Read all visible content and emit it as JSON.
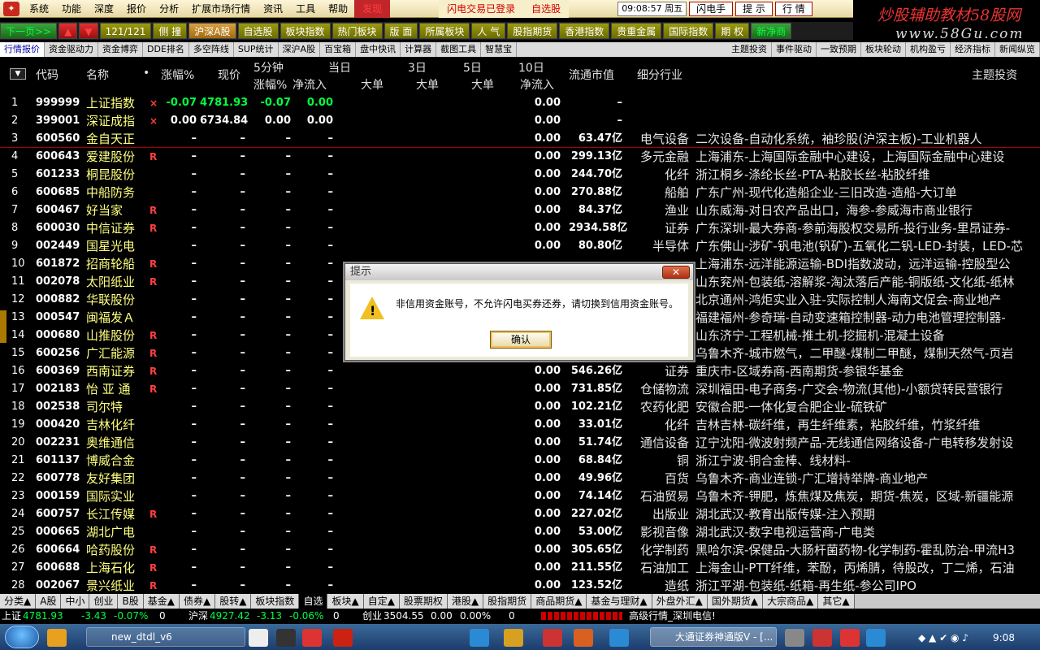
{
  "menubar": {
    "items": [
      "系统",
      "功能",
      "深度",
      "报价",
      "分析",
      "扩展市场行情",
      "资讯",
      "工具",
      "帮助"
    ],
    "discover": "发现",
    "notice1": "闪电交易已登录",
    "notice2": "自选股",
    "clock": "09:08:57 周五",
    "buttons": [
      "闪电手",
      "提 示",
      "行 情"
    ]
  },
  "brand": {
    "title_main": "炒股辅助教材",
    "title_red": "58股网",
    "url": "www.58Gu.com"
  },
  "toolbar": {
    "items": [
      {
        "label": "下一页>>",
        "style": "green"
      },
      {
        "label": "▲",
        "style": "red"
      },
      {
        "label": "▼",
        "style": "red"
      },
      {
        "label": "121/121",
        "style": "olive"
      },
      {
        "label": "侧 撞",
        "style": "olive"
      },
      {
        "label": "沪深A股",
        "style": "hl"
      },
      {
        "label": "自选股",
        "style": "olive"
      },
      {
        "label": "板块指数",
        "style": "olive"
      },
      {
        "label": "热门板块",
        "style": "olive"
      },
      {
        "label": "版 面",
        "style": "olive"
      },
      {
        "label": "所属板块",
        "style": "olive"
      },
      {
        "label": "人 气",
        "style": "olive"
      },
      {
        "label": "股指期货",
        "style": "olive"
      },
      {
        "label": "香港指数",
        "style": "olive"
      },
      {
        "label": "贵重金属",
        "style": "olive"
      },
      {
        "label": "国际指数",
        "style": "olive"
      },
      {
        "label": "期 权",
        "style": "olive"
      },
      {
        "label": "新净商",
        "style": "green"
      }
    ]
  },
  "tabs": {
    "left": [
      "行情报价",
      "资金驱动力",
      "资金博弈",
      "DDE排名",
      "多空阵线",
      "SUP统计",
      "深沪A股",
      "百宝箱",
      "盘中快讯",
      "计算器",
      "截图工具",
      "智慧宝"
    ],
    "right": [
      "主题投资",
      "事件驱动",
      "一致预期",
      "板块轮动",
      "机构盈亏",
      "经济指标",
      "新闻纵览"
    ]
  },
  "header": {
    "code": "代码",
    "name": "名称",
    "dot": "•",
    "pct": "涨幅%",
    "price": "现价",
    "min5": "5分钟",
    "min5_sub": "涨幅%",
    "flow": "净流入",
    "today": "当日",
    "today_sub": "大单",
    "d3": "3日",
    "d3_sub": "大单",
    "d5": "5日",
    "d5_sub": "大单",
    "d10": "10日",
    "d10_sub": "净流入",
    "mv": "流通市值",
    "industry": "细分行业",
    "theme": "主题投资"
  },
  "rows": [
    {
      "idx": "1",
      "code": "999999",
      "name": "上证指数",
      "flag": "×",
      "pct": "-0.07",
      "price": "4781.93",
      "m5": "-0.07",
      "flow": "0.00",
      "d1": "",
      "d3": "",
      "d5": "",
      "net": "0.00",
      "mv": "–",
      "ind": "",
      "theme": "",
      "color": "green"
    },
    {
      "idx": "2",
      "code": "399001",
      "name": "深证成指",
      "flag": "×",
      "pct": "0.00",
      "price": "6734.84",
      "m5": "0.00",
      "flow": "0.00",
      "d1": "",
      "d3": "",
      "d5": "",
      "net": "0.00",
      "mv": "–",
      "ind": "",
      "theme": "",
      "color": "white"
    },
    {
      "idx": "3",
      "code": "600560",
      "name": "金自天正",
      "flag": "",
      "pct": "–",
      "price": "–",
      "m5": "–",
      "flow": "–",
      "d1": "",
      "d3": "",
      "d5": "",
      "net": "0.00",
      "mv": "63.47亿",
      "ind": "电气设备",
      "theme": "二次设备-自动化系统，袖珍股(沪深主板)-工业机器人",
      "color": "white"
    },
    {
      "idx": "4",
      "code": "600643",
      "name": "爱建股份",
      "flag": "R",
      "pct": "–",
      "price": "–",
      "m5": "–",
      "flow": "–",
      "d1": "",
      "d3": "",
      "d5": "",
      "net": "0.00",
      "mv": "299.13亿",
      "ind": "多元金融",
      "theme": "上海浦东-上海国际金融中心建设，上海国际金融中心建设",
      "color": "white"
    },
    {
      "idx": "5",
      "code": "601233",
      "name": "桐昆股份",
      "flag": "",
      "pct": "–",
      "price": "–",
      "m5": "–",
      "flow": "–",
      "d1": "",
      "d3": "",
      "d5": "",
      "net": "0.00",
      "mv": "244.70亿",
      "ind": "化纤",
      "theme": "浙江桐乡-涤纶长丝-PTA-粘胶长丝-粘胶纤维",
      "color": "white"
    },
    {
      "idx": "6",
      "code": "600685",
      "name": "中船防务",
      "flag": "",
      "pct": "–",
      "price": "–",
      "m5": "–",
      "flow": "–",
      "d1": "",
      "d3": "",
      "d5": "",
      "net": "0.00",
      "mv": "270.88亿",
      "ind": "船舶",
      "theme": "广东广州-现代化造船企业-三旧改造-造船-大订单",
      "color": "white"
    },
    {
      "idx": "7",
      "code": "600467",
      "name": "好当家",
      "flag": "R",
      "pct": "–",
      "price": "–",
      "m5": "–",
      "flow": "–",
      "d1": "",
      "d3": "",
      "d5": "",
      "net": "0.00",
      "mv": "84.37亿",
      "ind": "渔业",
      "theme": "山东威海-对日农产品出口，海参-参威海市商业银行",
      "color": "white"
    },
    {
      "idx": "8",
      "code": "600030",
      "name": "中信证券",
      "flag": "R",
      "pct": "–",
      "price": "–",
      "m5": "–",
      "flow": "–",
      "d1": "",
      "d3": "",
      "d5": "",
      "net": "0.00",
      "mv": "2934.58亿",
      "ind": "证券",
      "theme": "广东深圳-最大券商-参前海股权交易所-投行业务-里昂证券-",
      "color": "white"
    },
    {
      "idx": "9",
      "code": "002449",
      "name": "国星光电",
      "flag": "",
      "pct": "–",
      "price": "–",
      "m5": "–",
      "flow": "–",
      "d1": "",
      "d3": "",
      "d5": "",
      "net": "0.00",
      "mv": "80.80亿",
      "ind": "半导体",
      "theme": "广东佛山-涉矿-钒电池(钒矿)-五氧化二钒-LED-封装，LED-芯",
      "color": "white"
    },
    {
      "idx": "10",
      "code": "601872",
      "name": "招商轮船",
      "flag": "R",
      "pct": "–",
      "price": "–",
      "m5": "–",
      "flow": "–",
      "d1": "",
      "d3": "",
      "d5": "",
      "net": "",
      "mv": "",
      "ind": "",
      "theme": "上海浦东-远洋能源运输-BDI指数波动，远洋运输-控股型公",
      "color": "white"
    },
    {
      "idx": "11",
      "code": "002078",
      "name": "太阳纸业",
      "flag": "R",
      "pct": "–",
      "price": "–",
      "m5": "–",
      "flow": "–",
      "d1": "",
      "d3": "",
      "d5": "",
      "net": "",
      "mv": "",
      "ind": "",
      "theme": "山东兖州-包装纸-溶解浆-淘汰落后产能-铜版纸-文化纸-纸林",
      "color": "white"
    },
    {
      "idx": "12",
      "code": "000882",
      "name": "华联股份",
      "flag": "",
      "pct": "–",
      "price": "–",
      "m5": "–",
      "flow": "–",
      "d1": "",
      "d3": "",
      "d5": "",
      "net": "",
      "mv": "",
      "ind": "",
      "theme": "北京通州-鸿炬实业入驻-实际控制人海南文促会-商业地产",
      "color": "white"
    },
    {
      "idx": "13",
      "code": "000547",
      "name": "闽福发Ａ",
      "flag": "",
      "pct": "–",
      "price": "–",
      "m5": "–",
      "flow": "–",
      "d1": "",
      "d3": "",
      "d5": "",
      "net": "",
      "mv": "",
      "ind": "",
      "theme": "福建福州-参奇瑞-自动变速箱控制器-动力电池管理控制器-",
      "color": "white"
    },
    {
      "idx": "14",
      "code": "000680",
      "name": "山推股份",
      "flag": "R",
      "pct": "–",
      "price": "–",
      "m5": "–",
      "flow": "–",
      "d1": "",
      "d3": "",
      "d5": "",
      "net": "",
      "mv": "",
      "ind": "",
      "theme": "山东济宁-工程机械-推土机-挖掘机-混凝土设备",
      "color": "white"
    },
    {
      "idx": "15",
      "code": "600256",
      "name": "广汇能源",
      "flag": "R",
      "pct": "–",
      "price": "–",
      "m5": "–",
      "flow": "–",
      "d1": "",
      "d3": "",
      "d5": "",
      "net": "",
      "mv": "",
      "ind": "",
      "theme": "乌鲁木齐-城市燃气，二甲醚-煤制二甲醚，煤制天然气-页岩",
      "color": "white"
    },
    {
      "idx": "16",
      "code": "600369",
      "name": "西南证券",
      "flag": "R",
      "pct": "–",
      "price": "–",
      "m5": "–",
      "flow": "–",
      "d1": "",
      "d3": "",
      "d5": "",
      "net": "0.00",
      "mv": "546.26亿",
      "ind": "证券",
      "theme": "重庆市-区域券商-西南期货-参银华基金",
      "color": "white"
    },
    {
      "idx": "17",
      "code": "002183",
      "name": "怡 亚 通",
      "flag": "R",
      "pct": "–",
      "price": "–",
      "m5": "–",
      "flow": "–",
      "d1": "",
      "d3": "",
      "d5": "",
      "net": "0.00",
      "mv": "731.85亿",
      "ind": "仓储物流",
      "theme": "深圳福田-电子商务-广交会-物流(其他)-小额贷转民营银行",
      "color": "white"
    },
    {
      "idx": "18",
      "code": "002538",
      "name": "司尔特",
      "flag": "",
      "pct": "–",
      "price": "–",
      "m5": "–",
      "flow": "–",
      "d1": "",
      "d3": "",
      "d5": "",
      "net": "0.00",
      "mv": "102.21亿",
      "ind": "农药化肥",
      "theme": "安徽合肥-一体化复合肥企业-硫铁矿",
      "color": "white"
    },
    {
      "idx": "19",
      "code": "000420",
      "name": "吉林化纤",
      "flag": "",
      "pct": "–",
      "price": "–",
      "m5": "–",
      "flow": "–",
      "d1": "",
      "d3": "",
      "d5": "",
      "net": "0.00",
      "mv": "33.01亿",
      "ind": "化纤",
      "theme": "吉林吉林-碳纤维，再生纤维素，粘胶纤维，竹浆纤维",
      "color": "white"
    },
    {
      "idx": "20",
      "code": "002231",
      "name": "奥维通信",
      "flag": "",
      "pct": "–",
      "price": "–",
      "m5": "–",
      "flow": "–",
      "d1": "",
      "d3": "",
      "d5": "",
      "net": "0.00",
      "mv": "51.74亿",
      "ind": "通信设备",
      "theme": "辽宁沈阳-微波射频产品-无线通信网络设备-广电转移发射设",
      "color": "white"
    },
    {
      "idx": "21",
      "code": "601137",
      "name": "博威合金",
      "flag": "",
      "pct": "–",
      "price": "–",
      "m5": "–",
      "flow": "–",
      "d1": "",
      "d3": "",
      "d5": "",
      "net": "0.00",
      "mv": "68.84亿",
      "ind": "铜",
      "theme": "浙江宁波-铜合金棒、线材料-",
      "color": "white"
    },
    {
      "idx": "22",
      "code": "600778",
      "name": "友好集团",
      "flag": "",
      "pct": "–",
      "price": "–",
      "m5": "–",
      "flow": "–",
      "d1": "",
      "d3": "",
      "d5": "",
      "net": "0.00",
      "mv": "49.96亿",
      "ind": "百货",
      "theme": "乌鲁木齐-商业连锁-广汇增持举牌-商业地产",
      "color": "white"
    },
    {
      "idx": "23",
      "code": "000159",
      "name": "国际实业",
      "flag": "",
      "pct": "–",
      "price": "–",
      "m5": "–",
      "flow": "–",
      "d1": "",
      "d3": "",
      "d5": "",
      "net": "0.00",
      "mv": "74.14亿",
      "ind": "石油贸易",
      "theme": "乌鲁木齐-钾肥，炼焦煤及焦炭，期货-焦炭，区域-新疆能源",
      "color": "white"
    },
    {
      "idx": "24",
      "code": "600757",
      "name": "长江传媒",
      "flag": "R",
      "pct": "–",
      "price": "–",
      "m5": "–",
      "flow": "–",
      "d1": "",
      "d3": "",
      "d5": "",
      "net": "0.00",
      "mv": "227.02亿",
      "ind": "出版业",
      "theme": "湖北武汉-教育出版传媒-注入预期",
      "color": "white"
    },
    {
      "idx": "25",
      "code": "000665",
      "name": "湖北广电",
      "flag": "",
      "pct": "–",
      "price": "–",
      "m5": "–",
      "flow": "–",
      "d1": "",
      "d3": "",
      "d5": "",
      "net": "0.00",
      "mv": "53.00亿",
      "ind": "影视音像",
      "theme": "湖北武汉-数字电视运营商-广电类",
      "color": "white"
    },
    {
      "idx": "26",
      "code": "600664",
      "name": "哈药股份",
      "flag": "R",
      "pct": "–",
      "price": "–",
      "m5": "–",
      "flow": "–",
      "d1": "",
      "d3": "",
      "d5": "",
      "net": "0.00",
      "mv": "305.65亿",
      "ind": "化学制药",
      "theme": "黑哈尔滨-保健品-大肠杆菌药物-化学制药-霍乱防治-甲流H3",
      "color": "white"
    },
    {
      "idx": "27",
      "code": "600688",
      "name": "上海石化",
      "flag": "R",
      "pct": "–",
      "price": "–",
      "m5": "–",
      "flow": "–",
      "d1": "",
      "d3": "",
      "d5": "",
      "net": "0.00",
      "mv": "211.55亿",
      "ind": "石油加工",
      "theme": "上海金山-PTT纤维，苯酚，丙烯腈，待股改，丁二烯，石油",
      "color": "white"
    },
    {
      "idx": "28",
      "code": "002067",
      "name": "景兴纸业",
      "flag": "R",
      "pct": "–",
      "price": "–",
      "m5": "–",
      "flow": "–",
      "d1": "",
      "d3": "",
      "d5": "",
      "net": "0.00",
      "mv": "123.52亿",
      "ind": "造纸",
      "theme": "浙江平湖-包装纸-纸箱-再生纸-参公司IPO",
      "color": "white"
    }
  ],
  "cattabs": [
    "分类▲",
    "A股",
    "中小",
    "创业",
    "B股",
    "基金▲",
    "债券▲",
    "股转▲",
    "板块指数",
    "自选",
    "板块▲",
    "自定▲",
    "股票期权",
    "港股▲",
    "股指期货",
    "商品期货▲",
    "基金与理财▲",
    "外盘外汇▲",
    "国外期货▲",
    "大宗商品▲",
    "其它▲"
  ],
  "cattab_active": "自选",
  "idxstrip": {
    "sh_label": "上证",
    "sh_val": "4781.93",
    "sh_chg": "-3.43",
    "sh_pct": "-0.07%",
    "sh_vol": "0",
    "hs_label": "沪深",
    "hs_val": "4927.42",
    "hs_chg": "-3.13",
    "hs_pct": "-0.06%",
    "hs_vol": "0",
    "cy_label": "创业",
    "cy_val": "3504.55",
    "cy_chg": "0.00",
    "cy_pct": "0.00%",
    "cy_vol": "0",
    "status": "高级行情_深圳电信!"
  },
  "taskbar": {
    "apps": [
      "new_dtdl_v6",
      "大通证券神通版V - [..."
    ],
    "time": "9:08"
  },
  "dialog": {
    "title": "提示",
    "close": "✕",
    "message": "非信用资金账号，不允许闪电买券还券，请切换到信用资金账号。",
    "ok": "确认"
  }
}
